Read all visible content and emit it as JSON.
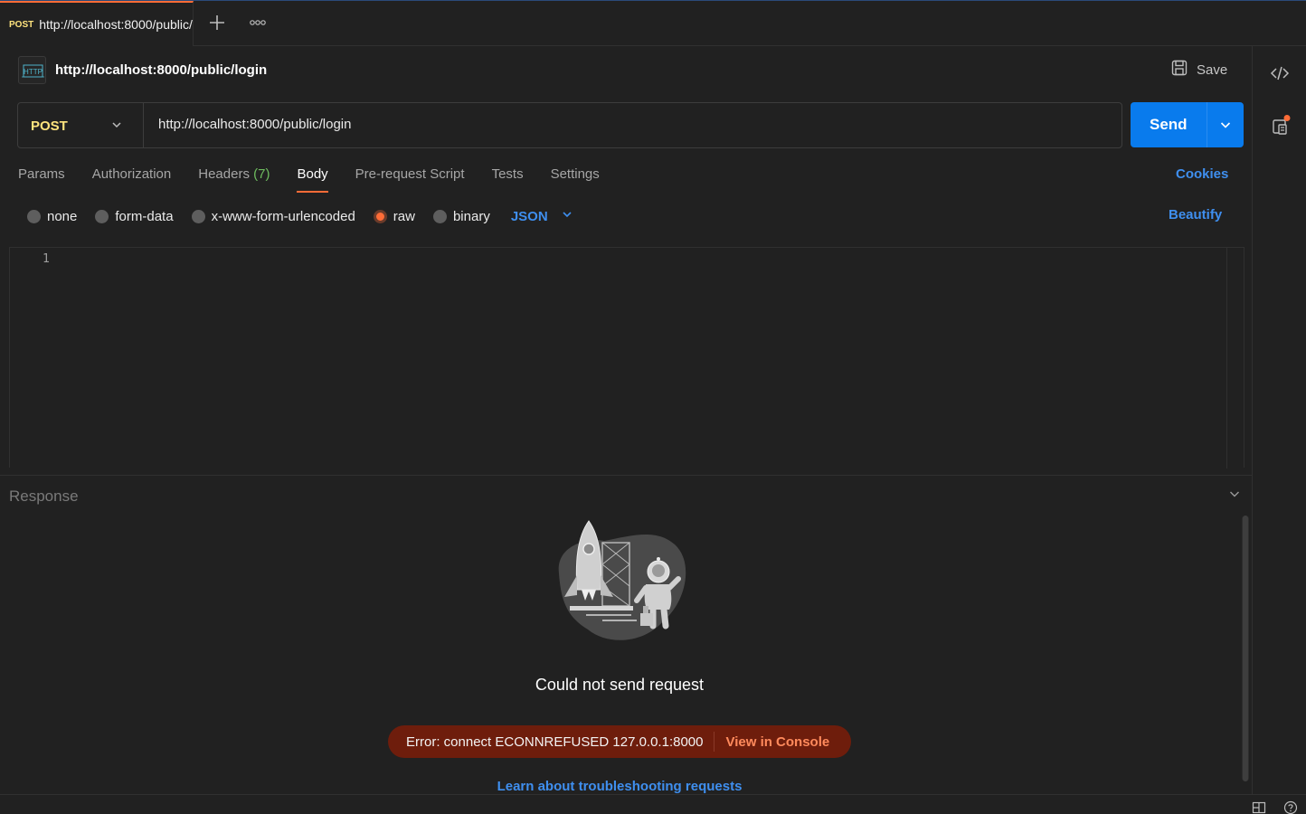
{
  "tab": {
    "method": "POST",
    "title": "http://localhost:8000/public/login"
  },
  "header": {
    "title": "http://localhost:8000/public/login",
    "save_label": "Save"
  },
  "request": {
    "method": "POST",
    "url": "http://localhost:8000/public/login",
    "send_label": "Send"
  },
  "tabs": {
    "params": "Params",
    "authorization": "Authorization",
    "headers": "Headers",
    "headers_count": "(7)",
    "body": "Body",
    "prerequest": "Pre-request Script",
    "tests": "Tests",
    "settings": "Settings",
    "cookies": "Cookies"
  },
  "body_types": {
    "none": "none",
    "form_data": "form-data",
    "urlencoded": "x-www-form-urlencoded",
    "raw": "raw",
    "binary": "binary",
    "selected": "raw",
    "language": "JSON",
    "beautify": "Beautify"
  },
  "editor": {
    "line_number": "1"
  },
  "response": {
    "title": "Response",
    "error_title": "Could not send request",
    "error_message": "Error: connect ECONNREFUSED 127.0.0.1:8000",
    "console_link": "View in Console",
    "learn_link": "Learn about troubleshooting requests"
  },
  "colors": {
    "accent": "#ff6c37",
    "send": "#097bed",
    "link": "#3f8fef",
    "method_post": "#ffe47e",
    "error_bg": "#6e1d0c"
  },
  "icons": [
    "plus-icon",
    "more-icon",
    "http-icon",
    "save-icon",
    "chevron-down-icon",
    "code-icon",
    "info-panel-icon",
    "rocket-illustration",
    "layout-icon",
    "help-icon"
  ]
}
